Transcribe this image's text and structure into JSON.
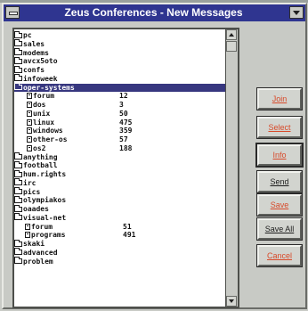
{
  "window": {
    "title": "Zeus Conferences - New Messages"
  },
  "list": [
    {
      "label": "pc",
      "kind": "folder",
      "count": ""
    },
    {
      "label": "sales",
      "kind": "folder",
      "count": ""
    },
    {
      "label": "modems",
      "kind": "folder",
      "count": ""
    },
    {
      "label": "avcx5oto",
      "kind": "folder",
      "count": ""
    },
    {
      "label": "confs",
      "kind": "folder",
      "count": ""
    },
    {
      "label": "infoweek",
      "kind": "folder",
      "count": ""
    },
    {
      "label": "oper-systems",
      "kind": "folder-open",
      "count": "",
      "selected": true
    },
    {
      "label": "forum",
      "kind": "doc",
      "count": "12"
    },
    {
      "label": "dos",
      "kind": "doc",
      "count": "3"
    },
    {
      "label": "unix",
      "kind": "doc",
      "count": "50"
    },
    {
      "label": "linux",
      "kind": "doc",
      "count": "475"
    },
    {
      "label": "windows",
      "kind": "doc",
      "count": "359"
    },
    {
      "label": "other-os",
      "kind": "doc",
      "count": "57"
    },
    {
      "label": "os2",
      "kind": "doc",
      "count": "188"
    },
    {
      "label": "anything",
      "kind": "folder",
      "count": ""
    },
    {
      "label": "football",
      "kind": "folder",
      "count": ""
    },
    {
      "label": "hum.rights",
      "kind": "folder",
      "count": ""
    },
    {
      "label": "irc",
      "kind": "folder",
      "count": ""
    },
    {
      "label": "pics",
      "kind": "folder",
      "count": ""
    },
    {
      "label": "olympiakos",
      "kind": "folder",
      "count": ""
    },
    {
      "label": "oaades",
      "kind": "folder",
      "count": ""
    },
    {
      "label": "visual-net",
      "kind": "folder",
      "count": ""
    },
    {
      "label": "forum",
      "kind": "doc2",
      "count": "51"
    },
    {
      "label": "programs",
      "kind": "doc2",
      "count": "491"
    },
    {
      "label": "skaki",
      "kind": "folder",
      "count": ""
    },
    {
      "label": "advanced",
      "kind": "folder",
      "count": ""
    },
    {
      "label": "problem",
      "kind": "folder",
      "count": ""
    }
  ],
  "buttons": {
    "join": "Join",
    "select": "Select",
    "info": "Info",
    "send": "Send",
    "save": "Save",
    "save_all": "Save All",
    "cancel": "Cancel"
  },
  "colors": {
    "titlebar": "#2f3590",
    "selection": "#37377f",
    "disabled_text": "#d84a2a"
  }
}
